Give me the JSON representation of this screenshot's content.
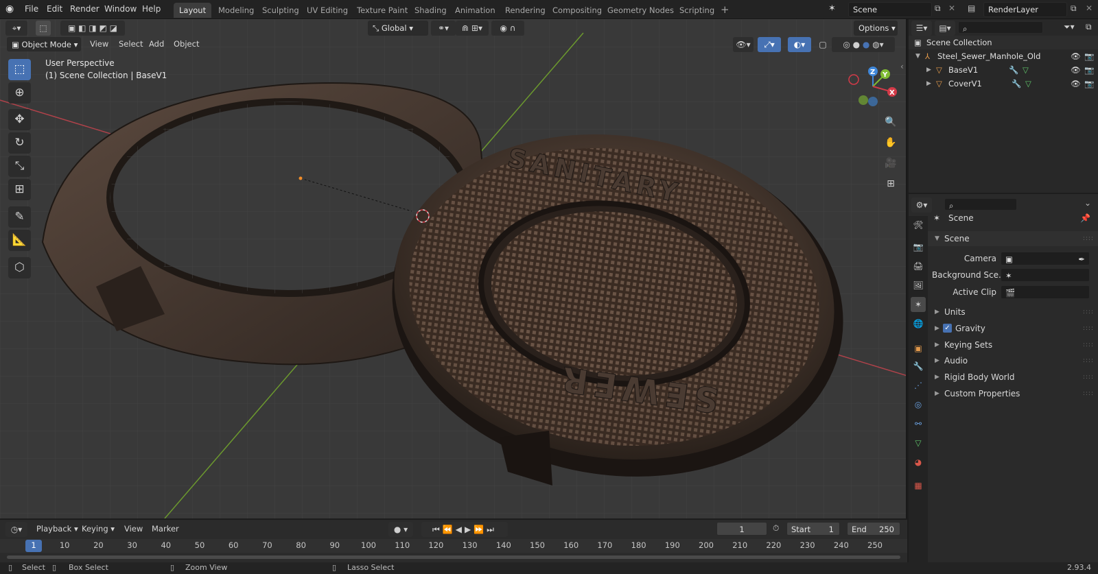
{
  "menus": {
    "file": "File",
    "edit": "Edit",
    "render": "Render",
    "window": "Window",
    "help": "Help"
  },
  "workspaces": [
    "Layout",
    "Modeling",
    "Sculpting",
    "UV Editing",
    "Texture Paint",
    "Shading",
    "Animation",
    "Rendering",
    "Compositing",
    "Geometry Nodes",
    "Scripting"
  ],
  "scene_field": "Scene",
  "render_layer_field": "RenderLayer",
  "viewport": {
    "transform_orientation": "Global",
    "options_label": "Options",
    "mode_label": "Object Mode",
    "menu_view": "View",
    "menu_select": "Select",
    "menu_add": "Add",
    "menu_object": "Object",
    "overlay_line1": "User Perspective",
    "overlay_line2": "(1) Scene Collection | BaseV1",
    "model_text_top": "SANITARY",
    "model_text_bottom": "SEWER",
    "gizmo_x": "X",
    "gizmo_y": "Y",
    "gizmo_z": "Z"
  },
  "outliner": {
    "root": "Scene Collection",
    "items": [
      {
        "name": "Steel_Sewer_Manhole_Old"
      },
      {
        "name": "BaseV1"
      },
      {
        "name": "CoverV1"
      }
    ]
  },
  "properties": {
    "header_title": "Scene",
    "section_title": "Scene",
    "camera_label": "Camera",
    "background_label": "Background Sce...",
    "active_clip_label": "Active Clip",
    "panels": [
      "Units",
      "Gravity",
      "Keying Sets",
      "Audio",
      "Rigid Body World",
      "Custom Properties"
    ],
    "gravity_checked": true
  },
  "timeline": {
    "playback": "Playback",
    "keying": "Keying",
    "view": "View",
    "marker": "Marker",
    "current_frame": "1",
    "start_label": "Start",
    "start_value": "1",
    "end_label": "End",
    "end_value": "250",
    "frame_marks": [
      "1",
      "10",
      "20",
      "30",
      "40",
      "50",
      "60",
      "70",
      "80",
      "90",
      "100",
      "110",
      "120",
      "130",
      "140",
      "150",
      "160",
      "170",
      "180",
      "190",
      "200",
      "210",
      "220",
      "230",
      "240",
      "250"
    ]
  },
  "status": {
    "select": "Select",
    "box_select": "Box Select",
    "zoom_view": "Zoom View",
    "lasso_select": "Lasso Select",
    "version": "2.93.4"
  },
  "colors": {
    "accent": "#4772b3",
    "x_axis": "#d33a48",
    "y_axis": "#7fbb32",
    "z_axis": "#3f87d9"
  }
}
